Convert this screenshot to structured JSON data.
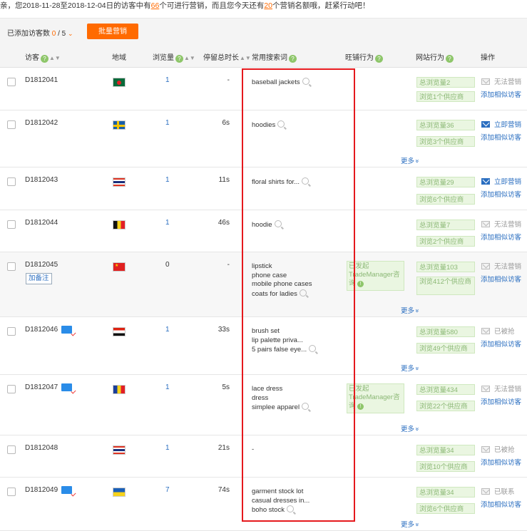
{
  "notice": {
    "prefix": "亲，您2018-11-28至2018-12-04日的访客中有",
    "count_available": "66",
    "middle": "个可进行营销，而且您今天还有",
    "count_quota": "20",
    "suffix": "个营销名额哦，赶紧行动吧！"
  },
  "toolbar": {
    "added_label": "已添加访客数",
    "added_count": "0",
    "added_total": "/ 5",
    "chevron": "⌄",
    "bulk_button": "批量营销"
  },
  "columns": {
    "visitor": "访客",
    "region": "地域",
    "views": "浏览量",
    "stay": "停留总时长",
    "keywords": "常用搜索词",
    "wangwang": "旺铺行为",
    "site": "网站行为",
    "ops": "操作"
  },
  "labels": {
    "more": "更多",
    "add_similar": "添加相似访客",
    "add_note": "加备注",
    "tm_text": "已发起TradeManager咨询"
  },
  "rows": [
    {
      "id": "D1812041",
      "flag": "bangladesh",
      "views": "1",
      "stay": "-",
      "keywords": [
        "baseball jackets"
      ],
      "total_views": "总浏览量2",
      "suppliers": "浏览1个供应商",
      "action": "无法营销",
      "action_style": "grey",
      "more": false,
      "tm": false,
      "card": false,
      "note": false
    },
    {
      "id": "D1812042",
      "flag": "sweden",
      "views": "1",
      "stay": "6s",
      "keywords": [
        "hoodies"
      ],
      "total_views": "总浏览量36",
      "suppliers": "浏览3个供应商",
      "action": "立即营销",
      "action_style": "blue",
      "more": true,
      "tm": false,
      "card": false,
      "note": false
    },
    {
      "id": "D1812043",
      "flag": "thailand",
      "views": "1",
      "stay": "11s",
      "keywords": [
        "floral shirts for..."
      ],
      "total_views": "总浏览量29",
      "suppliers": "浏览6个供应商",
      "action": "立即营销",
      "action_style": "blue",
      "more": false,
      "tm": false,
      "card": false,
      "note": false
    },
    {
      "id": "D1812044",
      "flag": "belgium",
      "views": "1",
      "stay": "46s",
      "keywords": [
        "hoodie"
      ],
      "total_views": "总浏览量7",
      "suppliers": "浏览2个供应商",
      "action": "无法营销",
      "action_style": "grey",
      "more": false,
      "tm": false,
      "card": false,
      "note": false
    },
    {
      "id": "D1812045",
      "flag": "china",
      "views": "0",
      "stay": "-",
      "keywords": [
        "lipstick",
        "phone case",
        "mobile phone cases",
        "coats for ladies"
      ],
      "total_views": "总浏览量103",
      "suppliers": "浏览412个供应商",
      "action": "无法营销",
      "action_style": "grey",
      "more": true,
      "tm": true,
      "card": false,
      "note": true
    },
    {
      "id": "D1812046",
      "flag": "egypt",
      "views": "1",
      "stay": "33s",
      "keywords": [
        "brush set",
        "lip palette priva...",
        "5 pairs false eye..."
      ],
      "total_views": "总浏览量580",
      "suppliers": "浏览49个供应商",
      "action": "已被抢",
      "action_style": "grey",
      "more": true,
      "tm": false,
      "card": true,
      "note": false
    },
    {
      "id": "D1812047",
      "flag": "romania",
      "views": "1",
      "stay": "5s",
      "keywords": [
        "lace dress",
        "dress",
        "simplee apparel"
      ],
      "total_views": "总浏览量434",
      "suppliers": "浏览22个供应商",
      "action": "无法营销",
      "action_style": "grey",
      "more": true,
      "tm": true,
      "card": true,
      "note": false
    },
    {
      "id": "D1812048",
      "flag": "thailand",
      "views": "1",
      "stay": "21s",
      "keywords": [
        "-"
      ],
      "total_views": "总浏览量34",
      "suppliers": "浏览10个供应商",
      "action": "已被抢",
      "action_style": "grey",
      "more": false,
      "tm": false,
      "card": false,
      "note": false
    },
    {
      "id": "D1812049",
      "flag": "ukraine",
      "views": "7",
      "stay": "74s",
      "keywords": [
        "garment stock lot",
        "casual dresses in...",
        "boho stock"
      ],
      "total_views": "总浏览量34",
      "suppliers": "浏览6个供应商",
      "action": "已联系",
      "action_style": "grey",
      "more": true,
      "tm": false,
      "card": true,
      "note": false
    }
  ],
  "colors": {
    "accent": "#ff6a00",
    "link": "#2a6ec0",
    "highlight_border": "#e5191d",
    "tag_bg": "#eaf6e1"
  }
}
